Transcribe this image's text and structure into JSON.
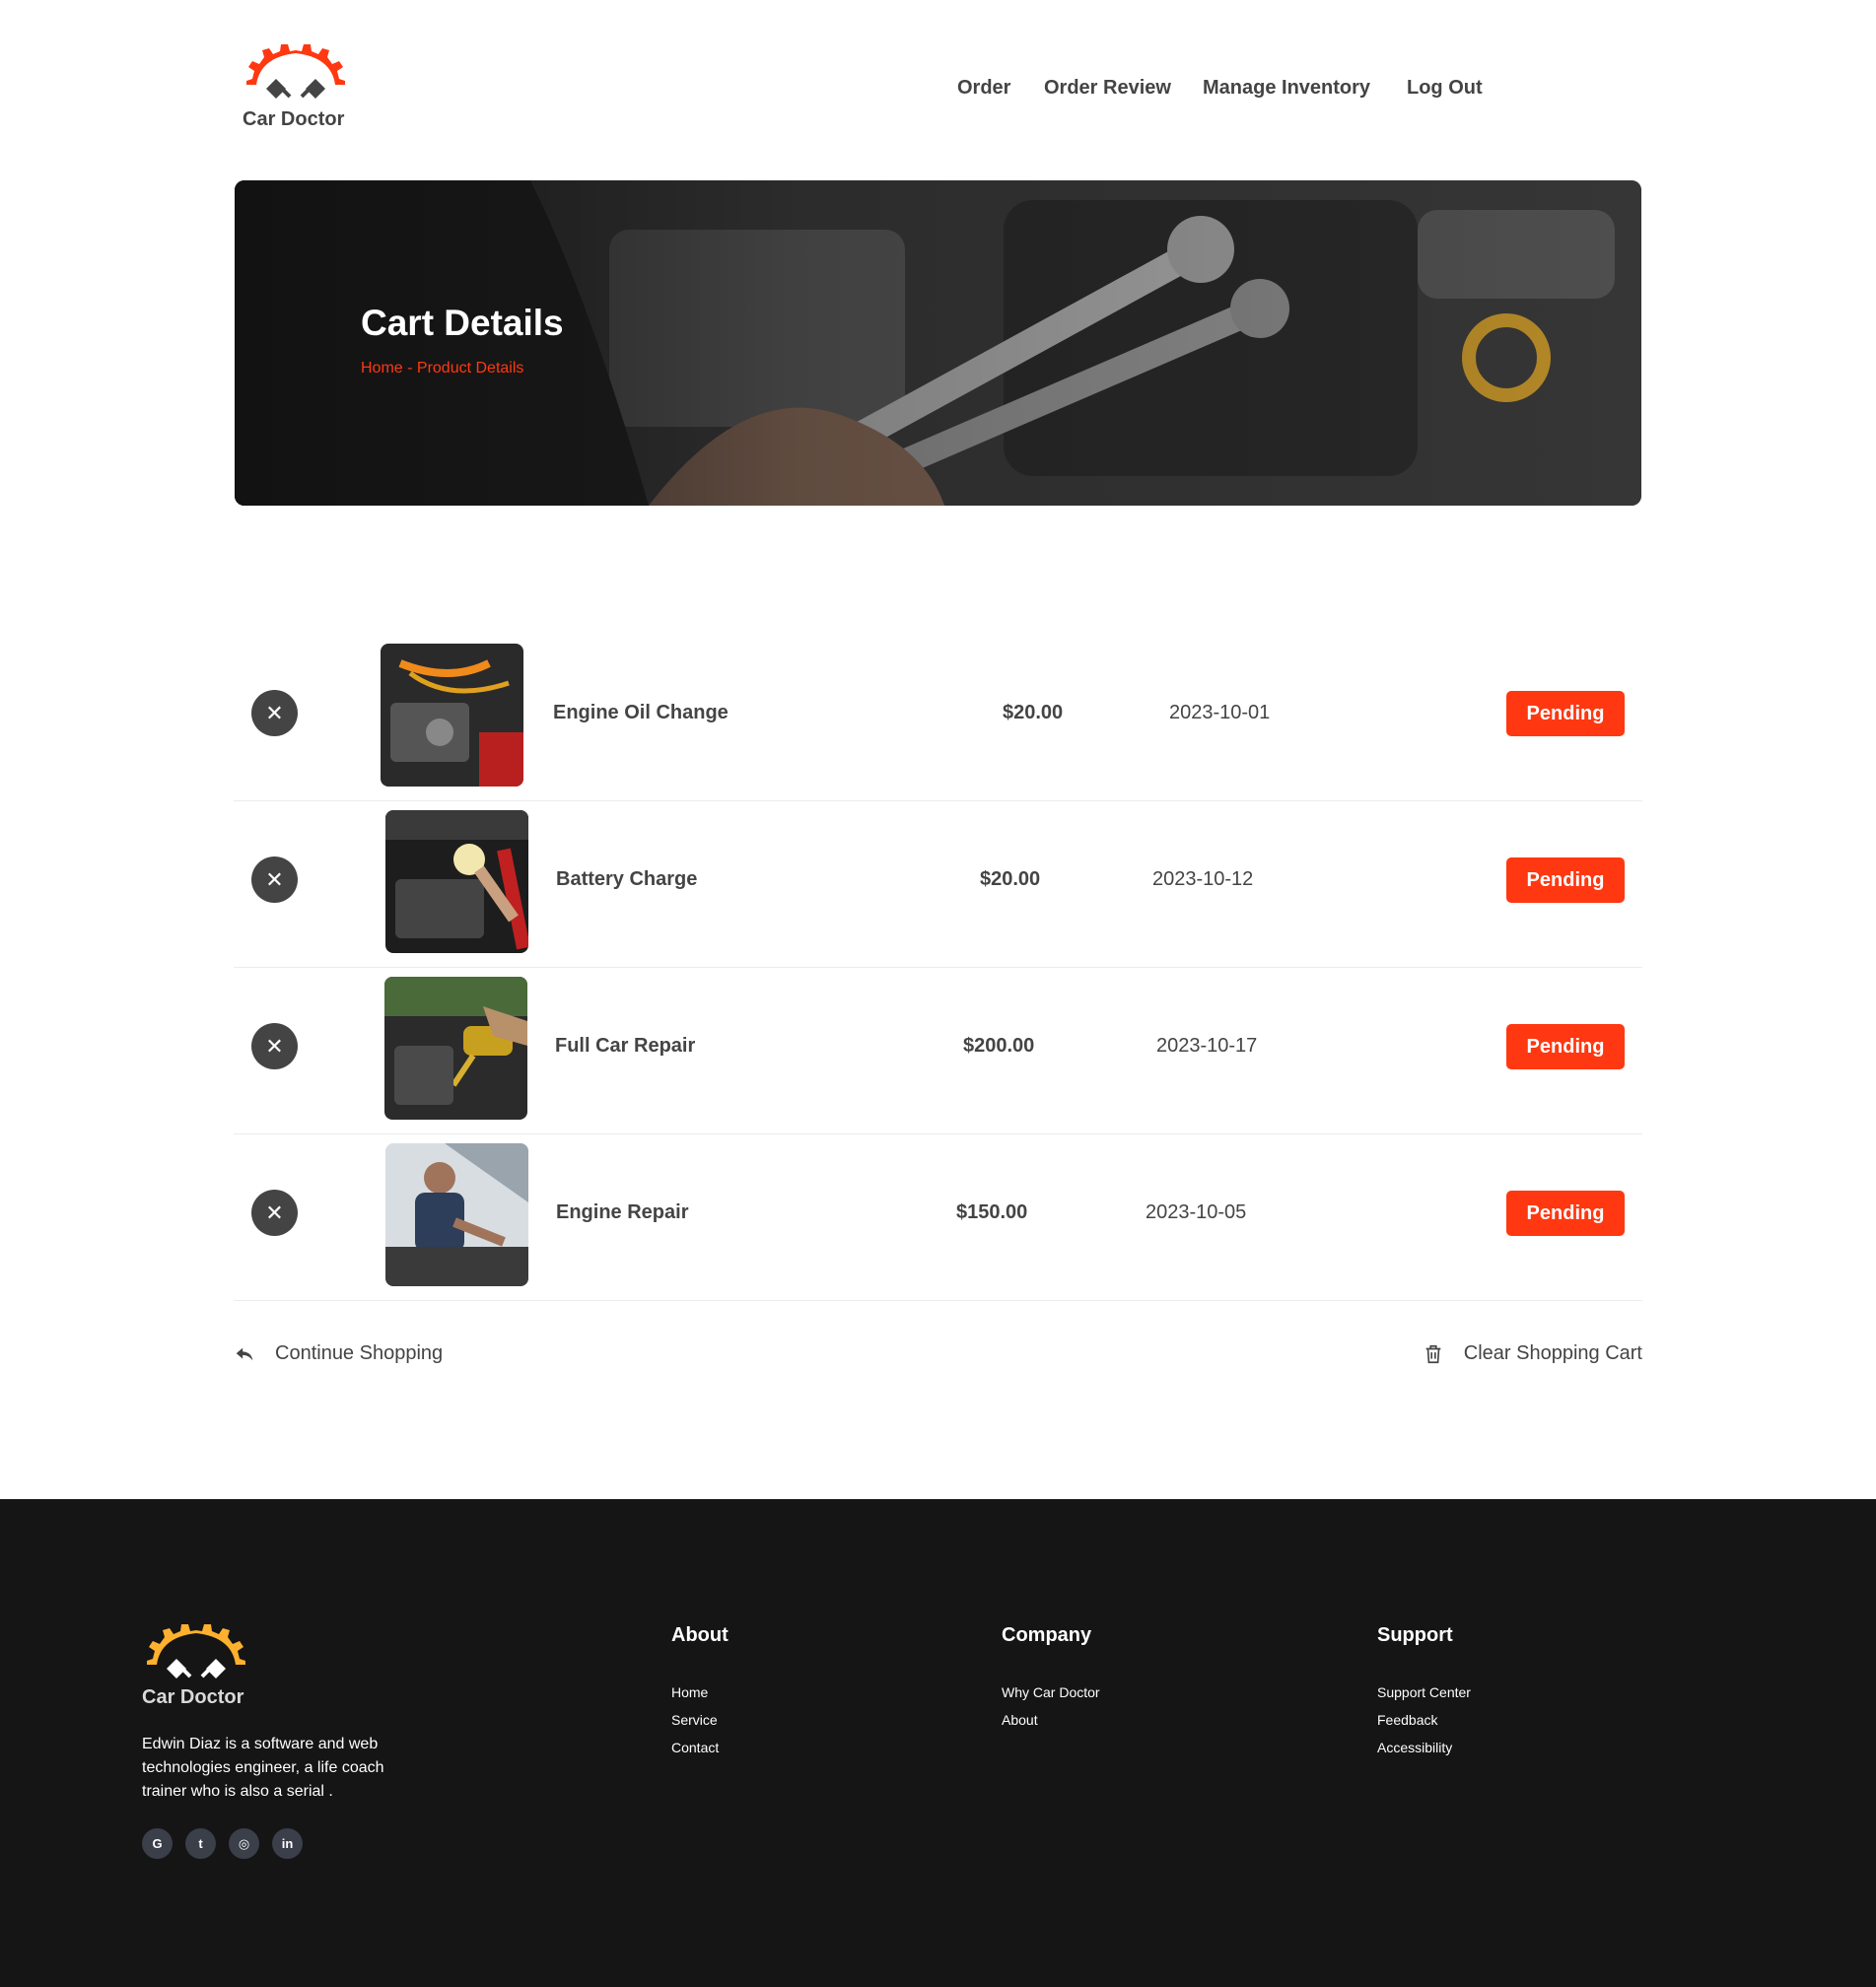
{
  "brand": {
    "name": "Car Doctor",
    "header_logo_color": "#ff3811",
    "footer_logo_color": "#ffb02e"
  },
  "nav": {
    "items": [
      {
        "label": "Order"
      },
      {
        "label": "Order Review"
      },
      {
        "label": "Manage Inventory"
      },
      {
        "label": "Log Out"
      }
    ]
  },
  "banner": {
    "title": "Cart Details",
    "breadcrumb": "Home - Product Details"
  },
  "cart": {
    "items": [
      {
        "name": "Engine Oil Change",
        "price": "$20.00",
        "date": "2023-10-01",
        "status": "Pending",
        "image_icon": "engine-photo"
      },
      {
        "name": "Battery Charge",
        "price": "$20.00",
        "date": "2023-10-12",
        "status": "Pending",
        "image_icon": "battery-photo"
      },
      {
        "name": "Full Car Repair",
        "price": "$200.00",
        "date": "2023-10-17",
        "status": "Pending",
        "image_icon": "oil-pour-photo"
      },
      {
        "name": "Engine Repair",
        "price": "$150.00",
        "date": "2023-10-05",
        "status": "Pending",
        "image_icon": "mechanic-photo"
      }
    ],
    "continue_label": "Continue Shopping",
    "clear_label": "Clear Shopping Cart"
  },
  "footer": {
    "brand": "Car Doctor",
    "description": "Edwin Diaz is a software and web technologies engineer, a life coach trainer who is also a serial .",
    "socials": [
      {
        "label": "G",
        "icon": "google-icon"
      },
      {
        "label": "t",
        "icon": "twitter-icon"
      },
      {
        "label": "◎",
        "icon": "instagram-icon"
      },
      {
        "label": "in",
        "icon": "linkedin-icon"
      }
    ],
    "columns": [
      {
        "title": "About",
        "links": [
          "Home",
          "Service",
          "Contact"
        ]
      },
      {
        "title": "Company",
        "links": [
          "Why Car Doctor",
          "About"
        ]
      },
      {
        "title": "Support",
        "links": [
          "Support Center",
          "Feedback",
          "Accessibility"
        ]
      }
    ]
  },
  "colors": {
    "accent": "#ff3811",
    "text": "#444444",
    "footer_bg": "#151515"
  }
}
